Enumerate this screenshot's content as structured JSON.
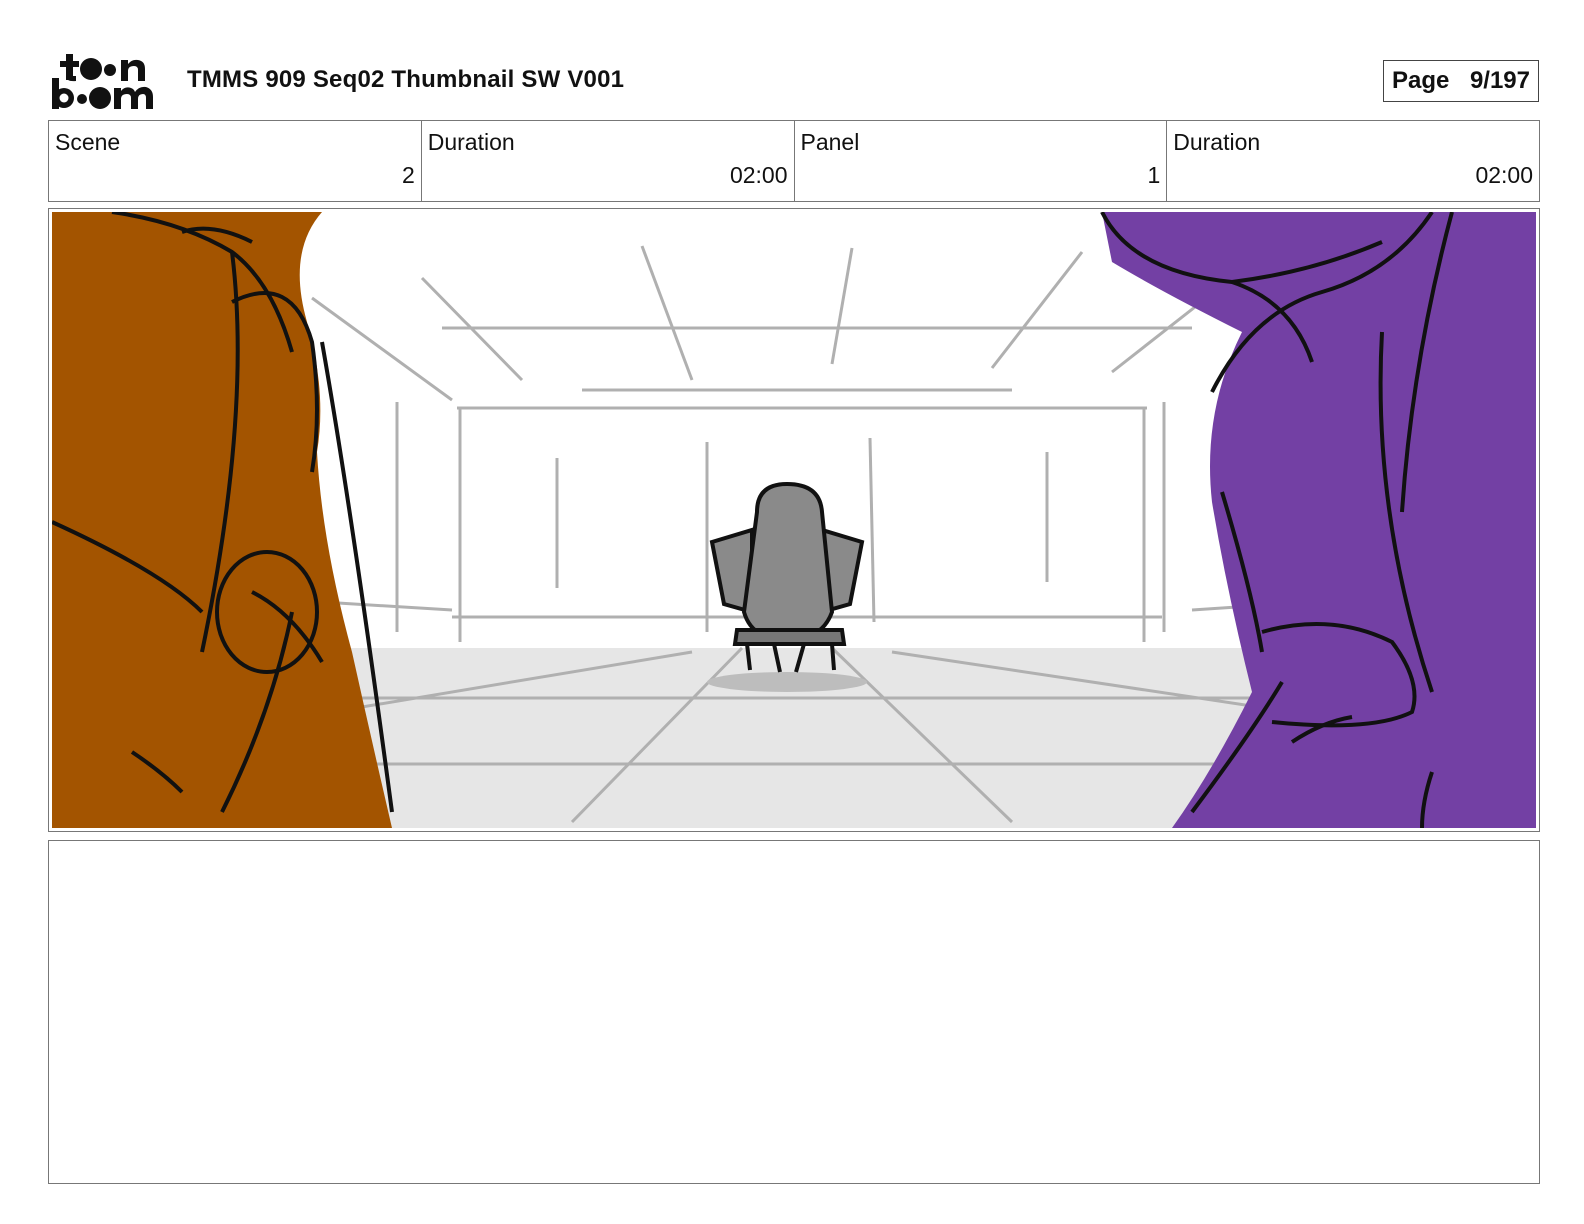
{
  "header": {
    "logo_text": "toon boom",
    "title": "TMMS 909 Seq02 Thumbnail SW V001",
    "page_label": "Page",
    "page_value": "9/197"
  },
  "info": [
    {
      "label": "Scene",
      "value": "2"
    },
    {
      "label": "Duration",
      "value": "02:00"
    },
    {
      "label": "Panel",
      "value": "1"
    },
    {
      "label": "Duration",
      "value": "02:00"
    }
  ],
  "panel": {
    "colors": {
      "left_character": "#a35400",
      "right_character": "#7340a4",
      "floor": "#e6e6e6",
      "figure": "#8a8a8a",
      "sketch_lines": "#b0b0b0"
    }
  },
  "notes": {
    "text": ""
  }
}
